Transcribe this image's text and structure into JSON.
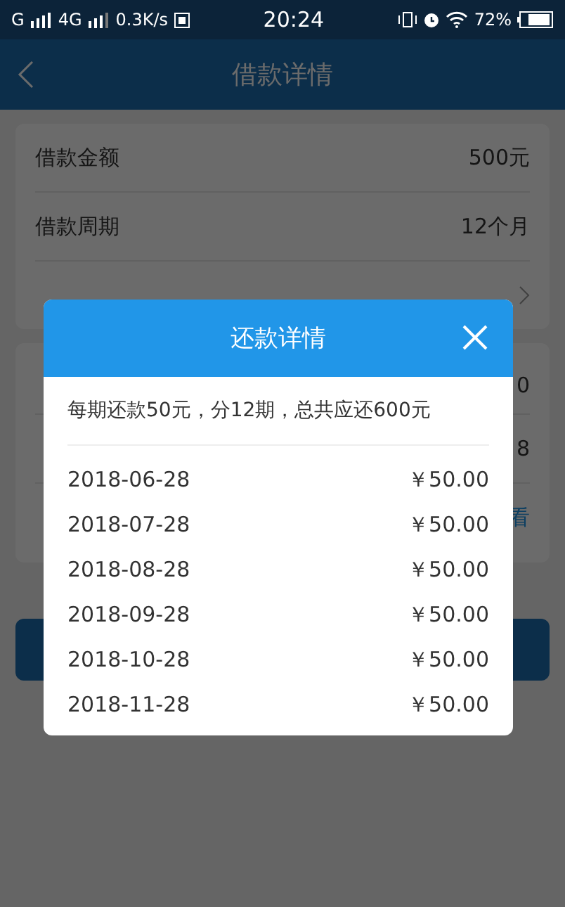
{
  "status_bar": {
    "network": "G",
    "network_2": "4G",
    "speed": "0.3K/s",
    "time": "20:24",
    "battery": "72%"
  },
  "header": {
    "title": "借款详情"
  },
  "loan_card": {
    "rows": [
      {
        "label": "借款金额",
        "value": "500元",
        "arrow": false
      },
      {
        "label": "借款周期",
        "value": "12个月",
        "arrow": false
      },
      {
        "arrow": true
      }
    ]
  },
  "repay_card": {
    "rows": [
      {
        "value": "0",
        "kind": "plain"
      },
      {
        "value": "8",
        "kind": "plain"
      },
      {
        "value": "看",
        "kind": "link"
      }
    ]
  },
  "dialog": {
    "title": "还款详情",
    "summary": "每期还款50元，分12期，总共应还600元",
    "rows": [
      {
        "date": "2018-06-28",
        "amount": "￥50.00"
      },
      {
        "date": "2018-07-28",
        "amount": "￥50.00"
      },
      {
        "date": "2018-08-28",
        "amount": "￥50.00"
      },
      {
        "date": "2018-09-28",
        "amount": "￥50.00"
      },
      {
        "date": "2018-10-28",
        "amount": "￥50.00"
      },
      {
        "date": "2018-11-28",
        "amount": "￥50.00"
      }
    ]
  }
}
